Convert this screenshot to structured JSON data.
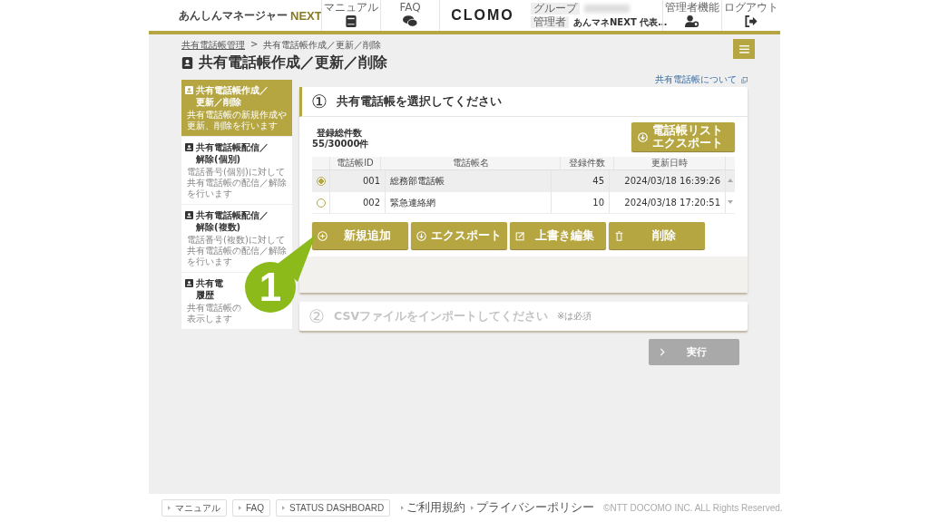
{
  "header": {
    "logo_text": "あんしんマネージャー",
    "logo_accent": "NEXT",
    "nav": [
      {
        "label": "マニュアル",
        "kind": "book"
      },
      {
        "label": "FAQ",
        "kind": "chat"
      }
    ],
    "brand": "CLOMO",
    "group_label": "グループ",
    "admin_label": "管理者",
    "admin_value": "あんマネNEXT 代表…",
    "actions": [
      {
        "label": "管理者機能",
        "kind": "usergear"
      },
      {
        "label": "ログアウト",
        "kind": "logout"
      }
    ]
  },
  "breadcrumb": [
    {
      "label": "共有電話帳管理",
      "link": true
    },
    {
      "label": "共有電話帳作成／更新／削除",
      "link": false
    }
  ],
  "breadcrumb_sep": ">",
  "page_title": "共有電話帳作成／更新／削除",
  "sidebar": {
    "items": [
      {
        "title": [
          "共有電話帳作成／",
          "更新／削除"
        ],
        "desc": [
          "共有電話帳の新規作成や",
          "更新、削除を行います"
        ],
        "selected": true
      },
      {
        "title": [
          "共有電話帳配信／",
          "解除(個別)"
        ],
        "desc": [
          "電話番号(個別)に対して",
          "共有電話帳の配信／解除",
          "を行います"
        ],
        "selected": false
      },
      {
        "title": [
          "共有電話帳配信／",
          "解除(複数)"
        ],
        "desc": [
          "電話番号(複数)に対して",
          "共有電話帳の配信／解除",
          "を行います"
        ],
        "selected": false
      },
      {
        "title": [
          "共有電",
          "履歴"
        ],
        "desc": [
          "共有電話帳の",
          "表示します"
        ],
        "selected": false
      }
    ]
  },
  "help_link": "共有電話帳について",
  "step1": {
    "number": "①",
    "title": "共有電話帳を選択してください",
    "count_label": "登録総件数",
    "count_value": "55/30000件",
    "export_list_button": [
      "電話帳リスト",
      "エクスポート"
    ],
    "table": {
      "columns": [
        "電話帳ID",
        "電話帳名",
        "登録件数",
        "更新日時"
      ],
      "rows": [
        {
          "id": "001",
          "name": "総務部電話帳",
          "count": "45",
          "updated": "2024/03/18 16:39:26",
          "selected": true
        },
        {
          "id": "002",
          "name": "緊急連絡網",
          "count": "10",
          "updated": "2024/03/18 17:20:51",
          "selected": false
        }
      ]
    },
    "buttons": [
      {
        "label": "新規追加",
        "kind": "add"
      },
      {
        "label": "エクスポート",
        "kind": "download"
      },
      {
        "label": "上書き編集",
        "kind": "edit"
      },
      {
        "label": "削除",
        "kind": "trash"
      }
    ]
  },
  "step2": {
    "number": "②",
    "title": "CSVファイルをインポートしてください",
    "note": "※は必須",
    "disabled": true
  },
  "run_button": {
    "label": "実行",
    "disabled": true
  },
  "callout": "1",
  "footer": {
    "buttons": [
      "マニュアル",
      "FAQ",
      "STATUS DASHBOARD"
    ],
    "links": [
      "ご利用規約",
      "プライバシーポリシー"
    ],
    "copyright": "©NTT DOCOMO INC. ALL Rights Reserved."
  }
}
